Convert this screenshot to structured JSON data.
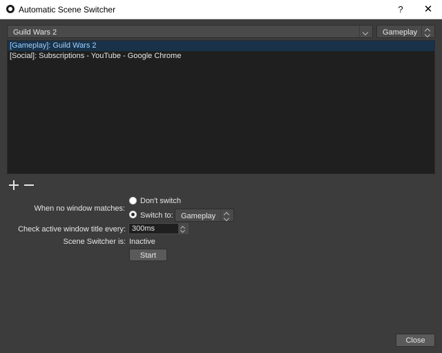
{
  "window": {
    "title": "Automatic Scene Switcher",
    "help_label": "?",
    "close_label": "✕"
  },
  "top": {
    "window_value": "Guild Wars 2",
    "scene_value": "Gameplay"
  },
  "list": {
    "items": [
      {
        "label": "[Gameplay]: Guild Wars 2",
        "selected": true
      },
      {
        "label": "[Social]: Subscriptions - YouTube - Google Chrome",
        "selected": false
      }
    ]
  },
  "options": {
    "no_match_label": "When no window matches:",
    "dont_switch_label": "Don't switch",
    "switch_to_label": "Switch to:",
    "switch_to_scene": "Gameplay",
    "check_interval_label": "Check active window title every:",
    "check_interval_value": "300ms",
    "status_label": "Scene Switcher is:",
    "status_value": "Inactive",
    "start_label": "Start"
  },
  "footer": {
    "close_label": "Close"
  },
  "colors": {
    "background": "#3c3c3c",
    "list_background": "#1f1f1f",
    "selection": "#19324a",
    "selection_text": "#9fd2ff"
  }
}
